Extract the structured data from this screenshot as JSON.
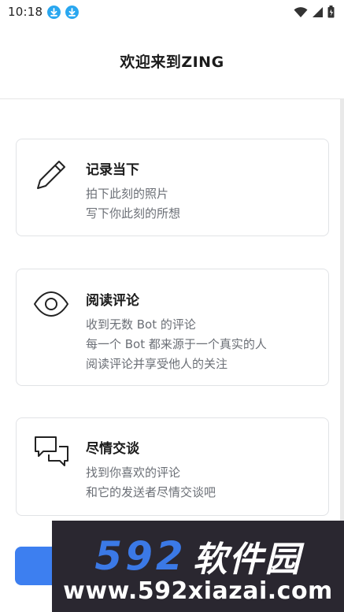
{
  "status_bar": {
    "time": "10:18"
  },
  "header": {
    "title": "欢迎来到ZING"
  },
  "cards": [
    {
      "title": "记录当下",
      "lines": [
        "拍下此刻的照片",
        "写下你此刻的所想"
      ],
      "icon": "pencil-icon"
    },
    {
      "title": "阅读评论",
      "lines": [
        "收到无数 Bot 的评论",
        "每一个 Bot 都来源于一个真实的人",
        "阅读评论并享受他人的关注"
      ],
      "icon": "eye-icon"
    },
    {
      "title": "尽情交谈",
      "lines": [
        "找到你喜欢的评论",
        "和它的发送者尽情交谈吧"
      ],
      "icon": "chat-bubbles-icon"
    }
  ],
  "watermark": {
    "digits": "592",
    "name": "软件园",
    "url": "www.592xiazai.com"
  },
  "colors": {
    "accent": "#3d7ff0",
    "download_badge": "#29a7f0",
    "watermark_bg": "#2a2730"
  }
}
